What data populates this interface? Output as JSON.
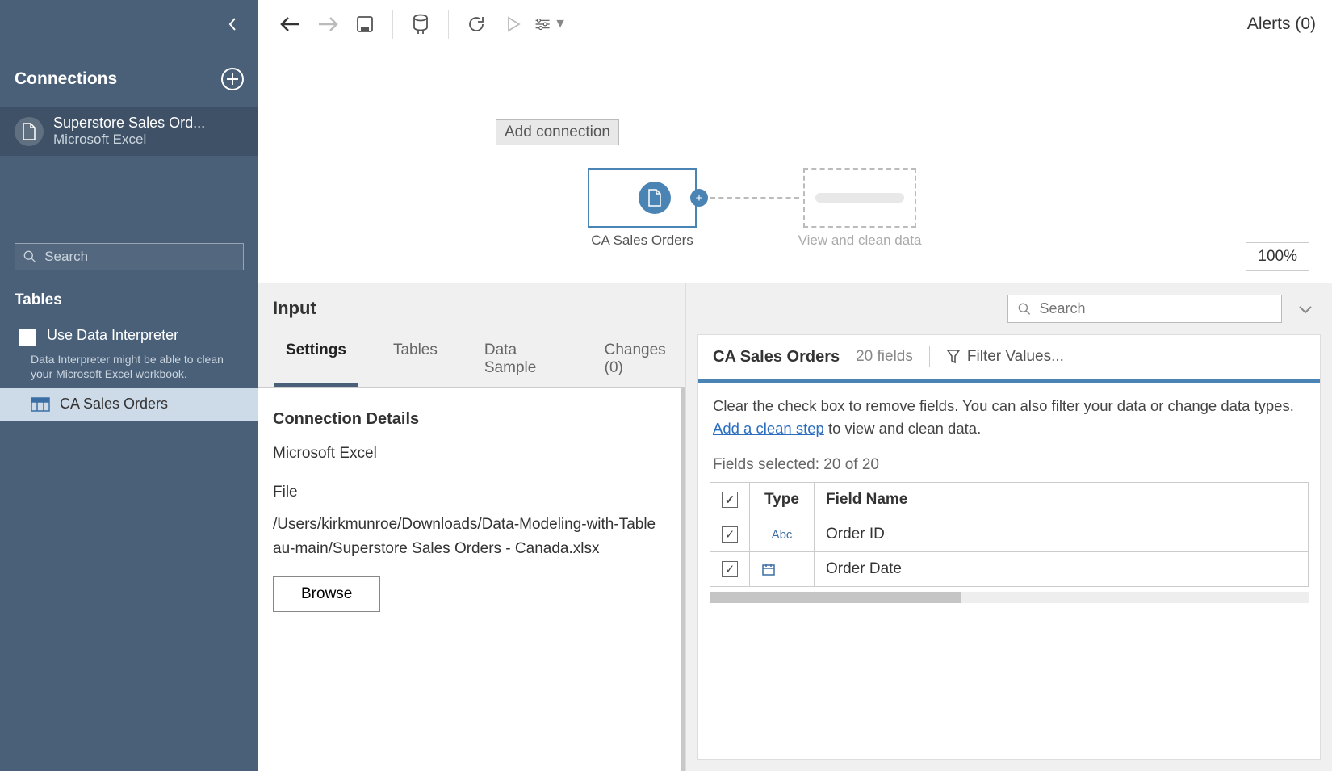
{
  "sidebar": {
    "connections_label": "Connections",
    "tooltip": "Add connection",
    "connection": {
      "title": "Superstore Sales Ord...",
      "subtitle": "Microsoft Excel"
    },
    "search_placeholder": "Search",
    "tables_label": "Tables",
    "interpreter_label": "Use Data Interpreter",
    "interpreter_hint": "Data Interpreter might be able to clean your Microsoft Excel workbook.",
    "table_item": "CA Sales Orders"
  },
  "toolbar": {
    "alerts": "Alerts (0)"
  },
  "canvas": {
    "node_label": "CA Sales Orders",
    "ghost_label": "View and clean data",
    "zoom": "100%"
  },
  "input_panel": {
    "title": "Input",
    "tabs": [
      "Settings",
      "Tables",
      "Data Sample",
      "Changes (0)"
    ],
    "settings": {
      "heading": "Connection Details",
      "conn_type": "Microsoft Excel",
      "file_label": "File",
      "file_path": "/Users/kirkmunroe/Downloads/Data-Modeling-with-Tableau-main/Superstore Sales Orders - Canada.xlsx",
      "browse": "Browse"
    }
  },
  "fields_panel": {
    "search_placeholder": "Search",
    "step_name": "CA Sales Orders",
    "field_count": "20 fields",
    "filter_label": "Filter Values...",
    "info_before": "Clear the check box to remove fields. You can also filter your data or change data types. ",
    "info_link": "Add a clean step",
    "info_after": " to view and clean data.",
    "selected": "Fields selected: 20 of 20",
    "headers": {
      "type": "Type",
      "name": "Field Name"
    },
    "rows": [
      {
        "type": "Abc",
        "name": "Order ID"
      },
      {
        "type": "date",
        "name": "Order Date"
      }
    ]
  }
}
